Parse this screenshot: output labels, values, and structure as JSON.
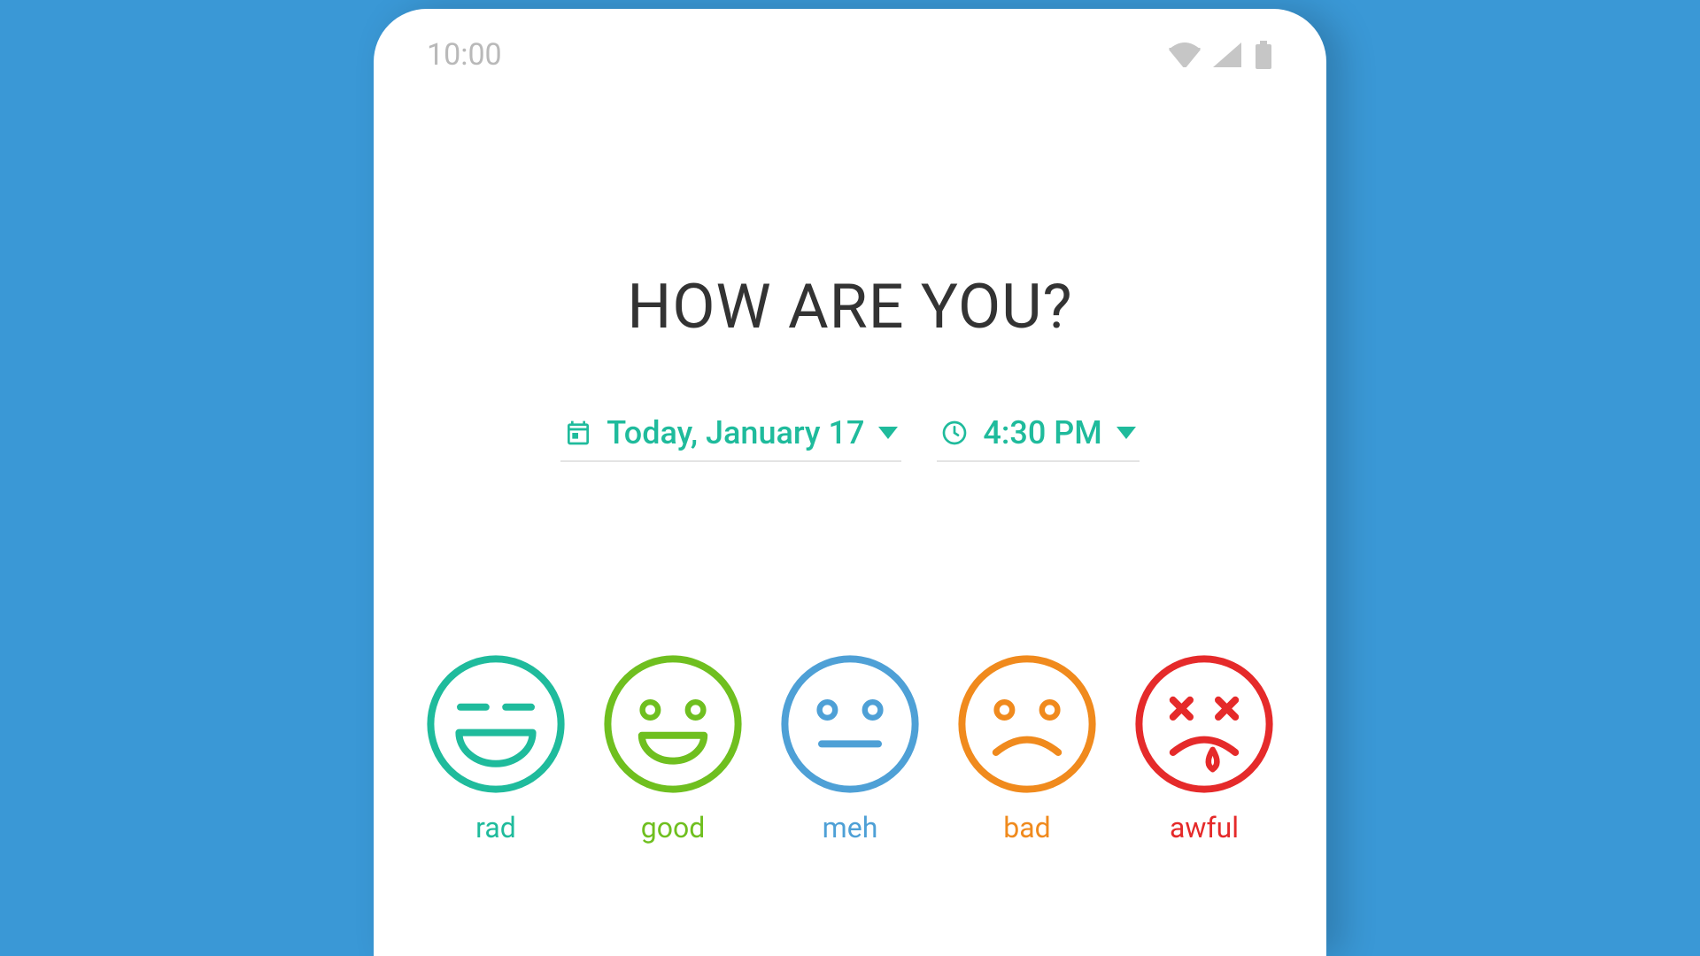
{
  "status": {
    "time": "10:00"
  },
  "headline": "HOW ARE YOU?",
  "date_picker": {
    "label": "Today, January 17"
  },
  "time_picker": {
    "label": "4:30 PM"
  },
  "moods": [
    {
      "label": "rad",
      "color": "#1fbb9c"
    },
    {
      "label": "good",
      "color": "#6fbf1f"
    },
    {
      "label": "meh",
      "color": "#4ea0d6"
    },
    {
      "label": "bad",
      "color": "#f08a1d"
    },
    {
      "label": "awful",
      "color": "#e52a2a"
    }
  ],
  "accent": "#1fbb9c"
}
